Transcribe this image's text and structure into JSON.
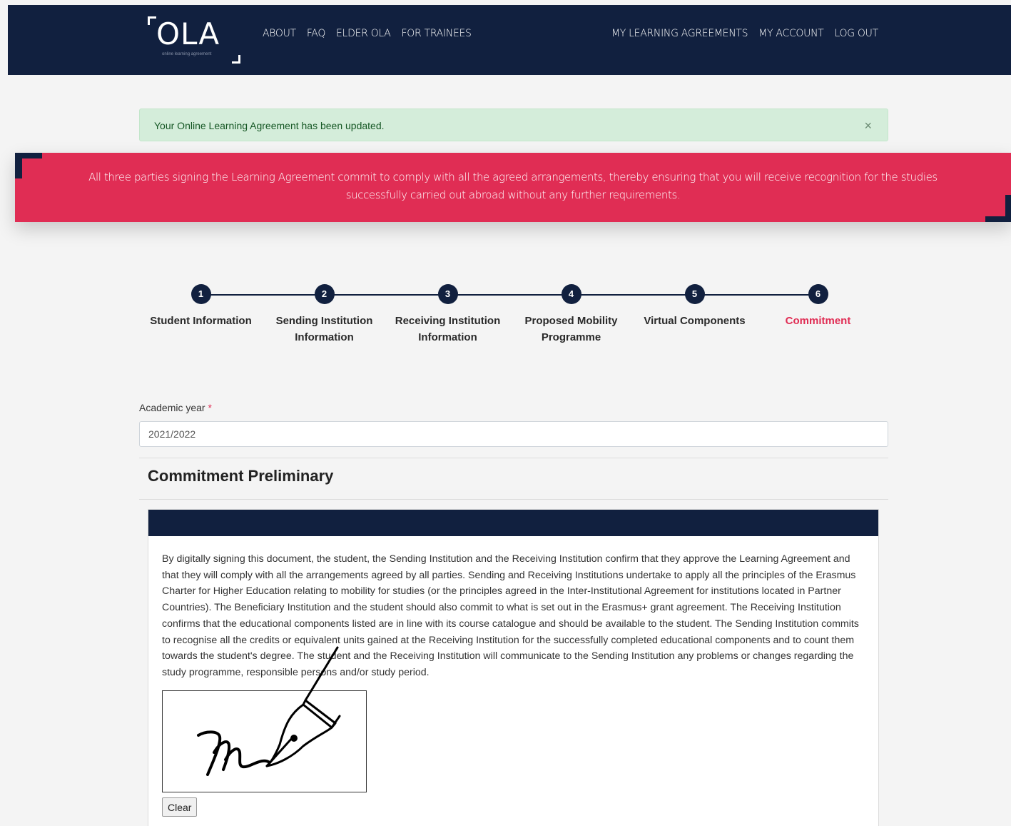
{
  "header": {
    "logo_text": "OLA",
    "logo_subtext": "online learning agreement",
    "nav_left": [
      "ABOUT",
      "FAQ",
      "ELDER OLA",
      "FOR TRAINEES"
    ],
    "nav_right": [
      "MY LEARNING AGREEMENTS",
      "MY ACCOUNT",
      "LOG OUT"
    ]
  },
  "alert": {
    "message": "Your Online Learning Agreement has been updated.",
    "close": "×"
  },
  "banner": {
    "text": "All three parties signing the Learning Agreement commit to comply with all the agreed arrangements, thereby ensuring that you will receive recognition for the studies successfully carried out abroad without any further requirements."
  },
  "steps": [
    {
      "number": "1",
      "label": "Student Information"
    },
    {
      "number": "2",
      "label": "Sending Institution Information"
    },
    {
      "number": "3",
      "label": "Receiving Institution Information"
    },
    {
      "number": "4",
      "label": "Proposed Mobility Programme"
    },
    {
      "number": "5",
      "label": "Virtual Components"
    },
    {
      "number": "6",
      "label": "Commitment"
    }
  ],
  "active_step": "6",
  "form": {
    "academic_year_label": "Academic year",
    "required_mark": "*",
    "academic_year_value": "2021/2022"
  },
  "section": {
    "title": "Commitment Preliminary",
    "commitment_text": "By digitally signing this document, the student, the Sending Institution and the Receiving Institution confirm that they approve the Learning Agreement and that they will comply with all the arrangements agreed by all parties. Sending and Receiving Institutions undertake to apply all the principles of the Erasmus Charter for Higher Education relating to mobility for studies (or the principles agreed in the Inter-Institutional Agreement for institutions located in Partner Countries). The Beneficiary Institution and the student should also commit to what is set out in the Erasmus+ grant agreement. The Receiving Institution confirms that the educational components listed are in line with its course catalogue and should be available to the student. The Sending Institution commits to recognise all the credits or equivalent units gained at the Receiving Institution for the successfully completed educational components and to count them towards the student's degree. The student and the Receiving Institution will communicate to the Sending Institution any problems or changes regarding the study programme, responsible persons and/or study period.",
    "clear_button": "Clear"
  },
  "colors": {
    "navy": "#11203f",
    "accent_red": "#e02d54",
    "success_bg": "#d4edda",
    "success_text": "#155724"
  }
}
